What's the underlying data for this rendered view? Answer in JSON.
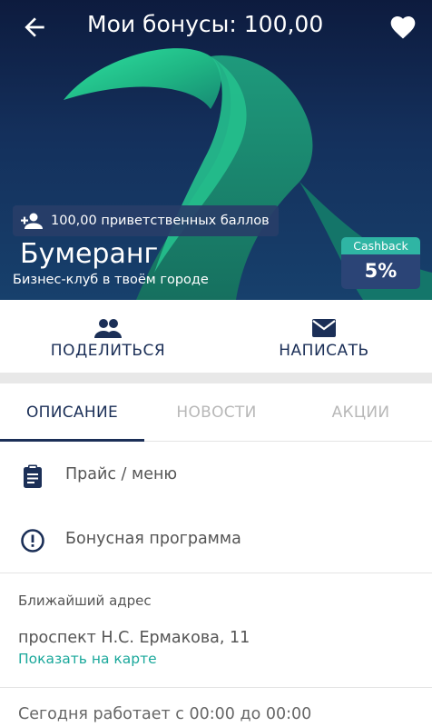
{
  "header": {
    "title": "Мои бонусы: 100,00",
    "back_icon": "arrow-left-icon",
    "favorite_icon": "heart-icon"
  },
  "hero": {
    "welcome_text": "100,00 приветственных баллов",
    "welcome_icon": "add-person-icon",
    "brand_name": "Бумеранг",
    "slogan": "Бизнес-клуб в твоём городе",
    "cashback": {
      "label": "Cashback",
      "value": "5%"
    }
  },
  "actions": [
    {
      "label": "ПОДЕЛИТЬСЯ",
      "icon": "people-icon"
    },
    {
      "label": "НАПИСАТЬ",
      "icon": "mail-icon"
    }
  ],
  "tabs": [
    {
      "label": "ОПИСАНИЕ",
      "active": true
    },
    {
      "label": "НОВОСТИ",
      "active": false
    },
    {
      "label": "АКЦИИ",
      "active": false
    }
  ],
  "menu": [
    {
      "label": "Прайс / меню",
      "icon": "clipboard-icon"
    },
    {
      "label": "Бонусная программа",
      "icon": "exclamation-circle-icon"
    }
  ],
  "address": {
    "title": "Ближайший адрес",
    "value": "проспект Н.С. Ермакова, 11",
    "map_link": "Показать на карте"
  },
  "hours": "Сегодня работает с 00:00 до 00:00",
  "colors": {
    "primary": "#1b2f57",
    "accent": "#2fb5a4",
    "link": "#1aa89b",
    "hero_dark": "#0d1b3e",
    "hero_green": "#22c98c"
  }
}
